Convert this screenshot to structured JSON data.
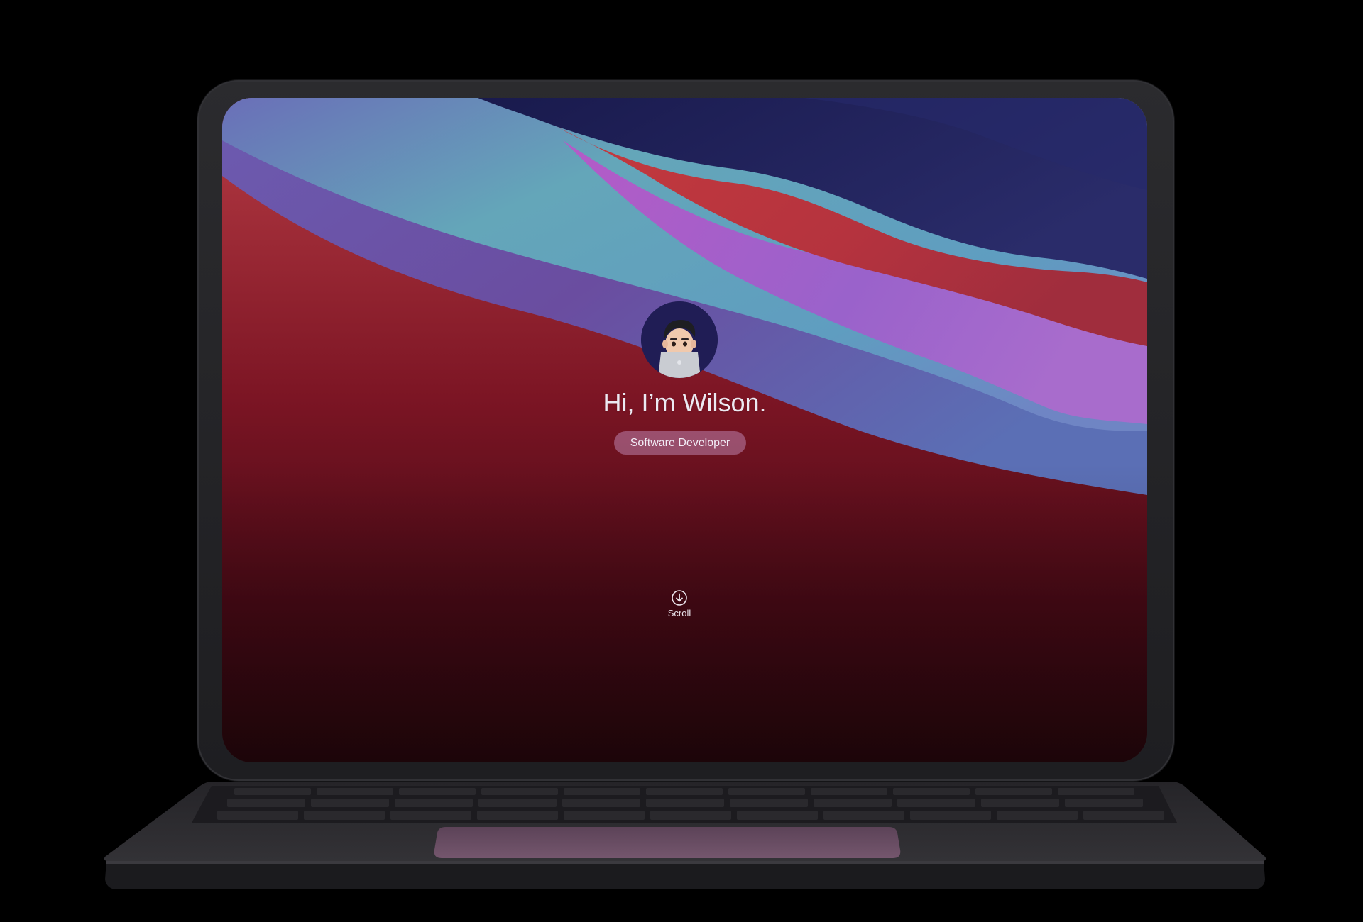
{
  "hero": {
    "title": "Hi, I’m Wilson.",
    "role": "Software Developer"
  },
  "scroll": {
    "label": "Scroll",
    "icon": "arrow-down-circle-icon"
  },
  "avatar": {
    "icon": "memoji-avatar"
  },
  "colors": {
    "background": "#000000",
    "bezel": "#262629",
    "deck": "#2e2d31",
    "trackpad": "#6e4f68",
    "wallpaper_navy": "#1b1d52",
    "wallpaper_teal": "#62a5b7",
    "wallpaper_red": "#b9343b",
    "wallpaper_purple": "#a35fc8",
    "wallpaper_dark": "#2e0810"
  }
}
